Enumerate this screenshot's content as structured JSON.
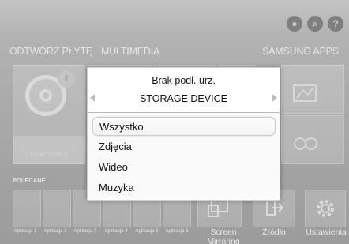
{
  "top_icons": [
    {
      "icon": "user-icon",
      "glyph": "●"
    },
    {
      "icon": "search-icon",
      "glyph": "⌕"
    },
    {
      "icon": "help-icon",
      "glyph": "?"
    }
  ],
  "sections": {
    "play_disc": "ODTWÓRZ PŁYTĘ",
    "multimedia": "MULTIMEDIA",
    "samsung_apps": "SAMSUNG APPS"
  },
  "disc_tile": {
    "status": "Brak dysku"
  },
  "recommended": {
    "label": "POLECANE",
    "apps": [
      "Aplikacja 1",
      "Aplikacja 2",
      "Aplikacja 3",
      "Aplikacja 4",
      "Aplikacja 5",
      "Aplikacja 6"
    ]
  },
  "utilities": {
    "screen_mirroring": "Screen Mirroring",
    "source": "Źródło",
    "settings": "Ustawienia"
  },
  "popup": {
    "title": "Brak podł. urz.",
    "subtitle": "STORAGE DEVICE",
    "items": [
      {
        "label": "Wszystko",
        "selected": true
      },
      {
        "label": "Zdjęcia",
        "selected": false
      },
      {
        "label": "Wideo",
        "selected": false
      },
      {
        "label": "Muzyka",
        "selected": false
      }
    ]
  },
  "colors": {
    "background": "#a8a8a8",
    "popup_background": "#fafafa",
    "selection_border": "#c9c9c9"
  }
}
